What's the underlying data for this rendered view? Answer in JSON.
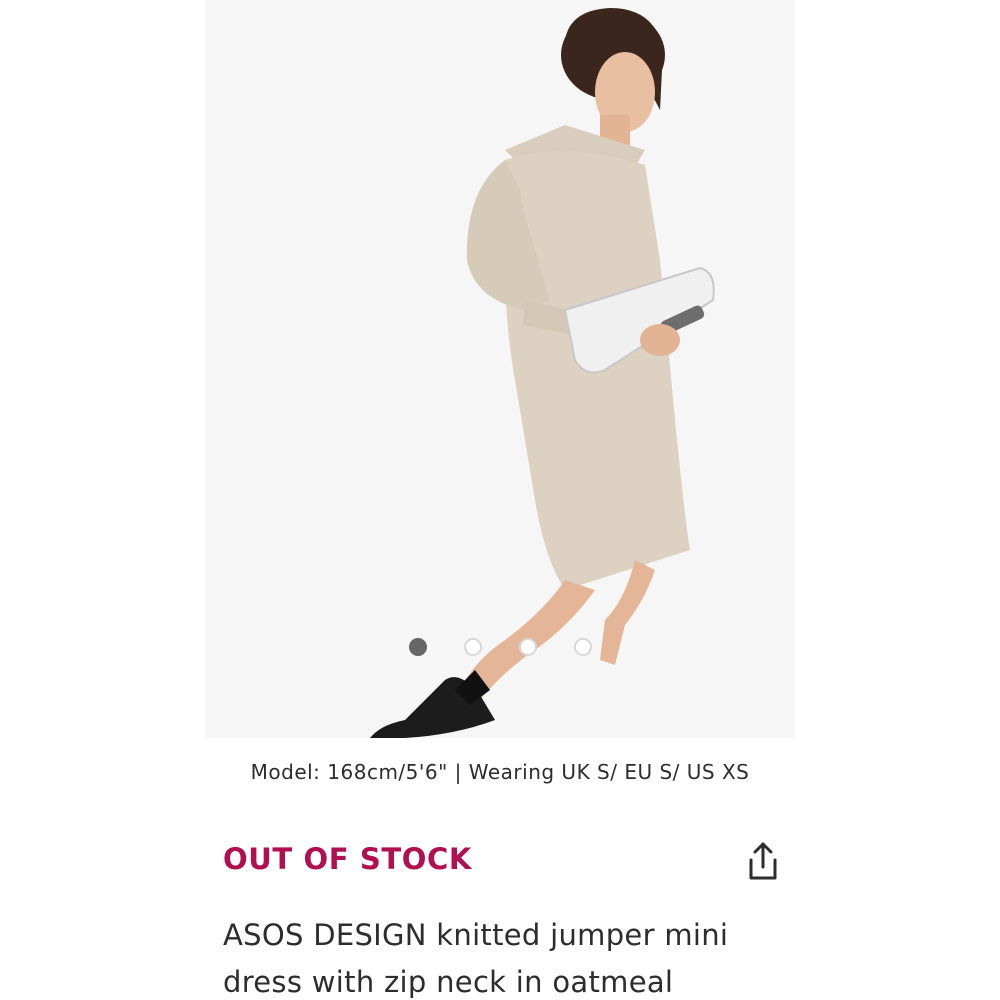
{
  "product": {
    "image_alt": "Model wearing knitted jumper mini dress",
    "carousel": {
      "total": 4,
      "active_index": 0
    },
    "model_info": "Model: 168cm/5'6\" | Wearing UK S/ EU S/ US XS",
    "stock_status": "OUT OF STOCK",
    "title": "ASOS DESIGN knitted jumper mini dress with zip neck in oatmeal"
  },
  "icons": {
    "share": "share-icon"
  },
  "colors": {
    "stock_status": "#b10f4f",
    "text": "#2d2d2d",
    "dot_active": "#666666",
    "dot_inactive_border": "#d8d8d8"
  }
}
